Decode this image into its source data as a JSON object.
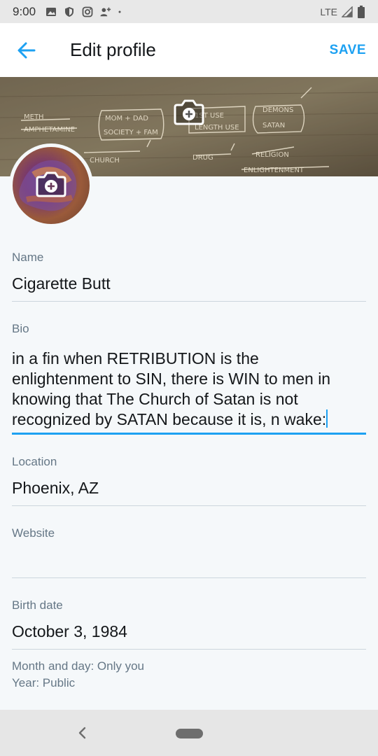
{
  "status_bar": {
    "time": "9:00",
    "network": "LTE",
    "icons": [
      "photo-icon",
      "shield-icon",
      "instagram-icon",
      "add-person-icon",
      "dot-icon",
      "signal-icon",
      "battery-icon"
    ]
  },
  "app_bar": {
    "title": "Edit profile",
    "save_label": "SAVE",
    "back_icon": "arrow-left-icon",
    "accent": "#1da1f2"
  },
  "header": {
    "camera_icon": "add-photo-icon",
    "image": "handwritten-notes-photo"
  },
  "avatar": {
    "camera_icon": "add-photo-icon"
  },
  "fields": {
    "name": {
      "label": "Name",
      "value": "Cigarette Butt"
    },
    "bio": {
      "label": "Bio",
      "lines": [
        "in a fin when RETRIBUTION is the",
        "enlightenment to SIN, there is WIN to men in",
        "knowing that The Church of Satan is not",
        "recognized by SATAN because it is, n wake:"
      ]
    },
    "location": {
      "label": "Location",
      "value": "Phoenix, AZ"
    },
    "website": {
      "label": "Website",
      "value": ""
    },
    "birth_date": {
      "label": "Birth date",
      "value": "October 3, 1984"
    }
  },
  "privacy": {
    "line1": "Month and day: Only you",
    "line2": "Year: Public"
  }
}
